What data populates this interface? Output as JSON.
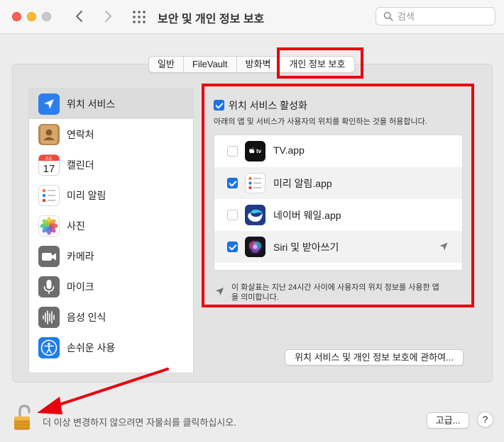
{
  "window": {
    "title": "보안 및 개인 정보 보호",
    "search_placeholder": "검색"
  },
  "tabs": [
    {
      "label": "일반",
      "active": false
    },
    {
      "label": "FileVault",
      "active": false
    },
    {
      "label": "방화벽",
      "active": false
    },
    {
      "label": "개인 정보 보호",
      "active": true
    }
  ],
  "sidebar": {
    "items": [
      {
        "label": "위치 서비스",
        "icon": "location-arrow-icon",
        "selected": true
      },
      {
        "label": "연락처",
        "icon": "contacts-icon",
        "selected": false
      },
      {
        "label": "캘린더",
        "icon": "calendar-icon",
        "selected": false
      },
      {
        "label": "미리 알림",
        "icon": "reminders-icon",
        "selected": false
      },
      {
        "label": "사진",
        "icon": "photos-icon",
        "selected": false
      },
      {
        "label": "카메라",
        "icon": "camera-icon",
        "selected": false
      },
      {
        "label": "마이크",
        "icon": "microphone-icon",
        "selected": false
      },
      {
        "label": "음성 인식",
        "icon": "speech-recognition-icon",
        "selected": false
      },
      {
        "label": "손쉬운 사용",
        "icon": "accessibility-icon",
        "selected": false
      }
    ],
    "calendar_month": "JUL",
    "calendar_day": "17"
  },
  "location": {
    "enable_label": "위치 서비스 활성화",
    "enable_checked": true,
    "description": "아래의 앱 및 서비스가 사용자의 위치를 확인하는 것을 허용합니다.",
    "apps": [
      {
        "label": "TV.app",
        "checked": false,
        "icon": "apple-tv-icon",
        "recent": false
      },
      {
        "label": "미리 알림.app",
        "checked": true,
        "icon": "reminders-icon",
        "recent": false
      },
      {
        "label": "네이버 웨일.app",
        "checked": false,
        "icon": "naver-whale-icon",
        "recent": false
      },
      {
        "label": "Siri 및 받아쓰기",
        "checked": true,
        "icon": "siri-icon",
        "recent": true
      }
    ],
    "note": "이 화살표는 지난 24시간 사이에 사용자의 위치 정보를 사용한 앱을 의미합니다.",
    "about_button": "위치 서비스 및 개인 정보 보호에 관하여..."
  },
  "footer": {
    "lock_text": "더 이상 변경하지 않으려면 자물쇠를 클릭하십시오.",
    "advanced_button": "고급...",
    "help_button": "?"
  },
  "colors": {
    "highlight": "#e8000f",
    "accent": "#1a74e8"
  }
}
